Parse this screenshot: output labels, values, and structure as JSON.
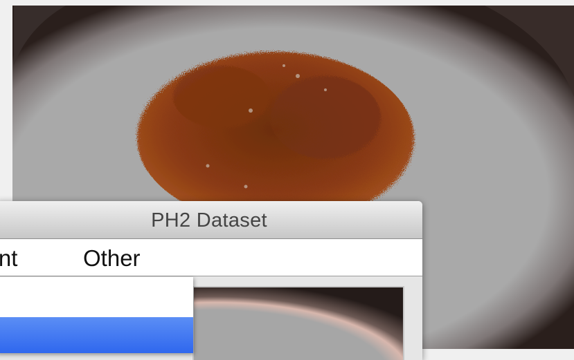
{
  "background": {
    "skin_color": "#a7a7a7",
    "lesion_color": "#8a3a12",
    "vignette_color": "#2a1f1c"
  },
  "window": {
    "title": "PH2 Dataset"
  },
  "menubar": {
    "items": [
      {
        "label": "ment",
        "icon": null
      },
      {
        "label": "Other",
        "icon": null
      }
    ]
  },
  "dropdown": {
    "highlight_color": "#3a73f0",
    "items": [
      {
        "label": ""
      },
      {
        "label": "",
        "selected": true
      }
    ]
  }
}
